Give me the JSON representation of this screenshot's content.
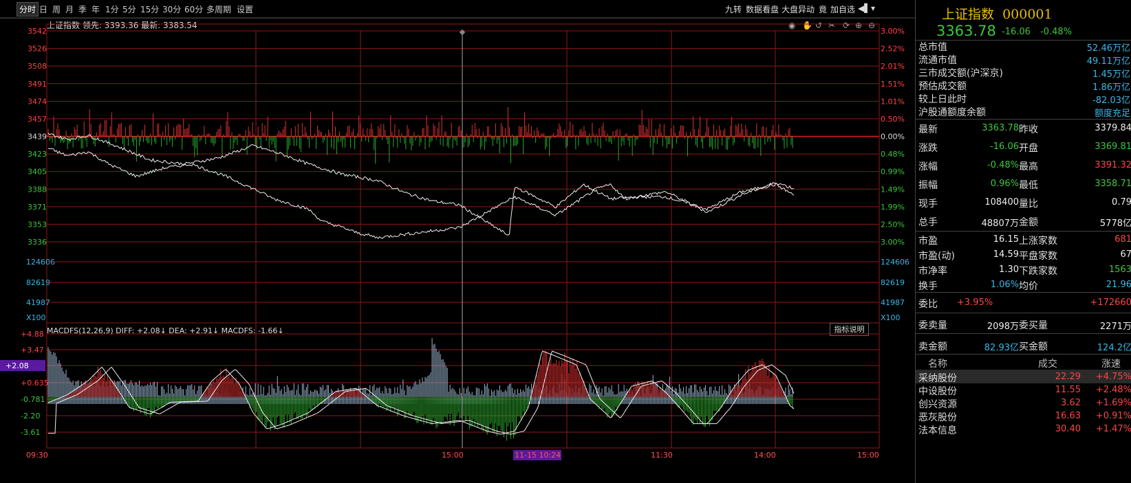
{
  "toolbar": {
    "tabs": [
      "分时",
      "日",
      "周",
      "月",
      "季",
      "年",
      "1分",
      "5分",
      "15分",
      "30分",
      "60分",
      "多周期",
      "设置"
    ],
    "right": [
      "九转",
      "数据看盘",
      "大盘异动",
      "竟",
      "加自选"
    ]
  },
  "chart": {
    "title_name": "上证指数",
    "title_lead": "领先:",
    "lead_value": "3393.36",
    "title_latest": "最新:",
    "latest_value": "3383.54"
  },
  "chart_data": [
    {
      "type": "line",
      "name": "price",
      "y_left_ticks": [
        "3542",
        "3526",
        "3508",
        "3491",
        "3474",
        "3457",
        "3439",
        "3423",
        "3405",
        "3388",
        "3371",
        "3353",
        "3336"
      ],
      "y_right_ticks": [
        "3.00%",
        "2.52%",
        "2.01%",
        "1.51%",
        "1.01%",
        "0.50%",
        "0.00%",
        "0.48%",
        "0.99%",
        "1.49%",
        "1.99%",
        "2.50%",
        "3.00%"
      ],
      "x_ticks": [
        "09:30",
        "15:00",
        "11-15 10:24",
        "11:30",
        "14:00",
        "15:00"
      ],
      "ylim": [
        3336,
        3542
      ],
      "base": 3439
    },
    {
      "type": "bar",
      "name": "volume",
      "y_ticks": [
        "124606",
        "82619",
        "41987",
        "X100"
      ]
    },
    {
      "type": "bar",
      "name": "macd",
      "legend": "MACDFS(12,26,9) DIFF: +2.08↓ DEA: +2.91↓ MACDFS: -1.66↓",
      "y_ticks": [
        "+4.88",
        "+3.47",
        "+2.08",
        "+0.635",
        "-0.781",
        "-2.20",
        "-3.61"
      ],
      "ylim": [
        -4.3,
        5.3
      ]
    }
  ],
  "macd_button": "指标说明",
  "side": {
    "name": "上证指数",
    "code": "000001",
    "price": "3363.78",
    "change": "-16.06",
    "pct": "-0.48%",
    "rows1": [
      {
        "k": "总市值",
        "v": "52.46万亿",
        "c": "cyan"
      },
      {
        "k": "流通市值",
        "v": "49.11万亿",
        "c": "cyan"
      },
      {
        "k": "三市成交额(沪深京)",
        "v": "1.45万亿",
        "c": "cyan"
      },
      {
        "k": "预估成交额",
        "v": "1.86万亿",
        "c": "cyan"
      },
      {
        "k": "较上日此时",
        "v": "-82.03亿",
        "c": "cyan"
      },
      {
        "k": "沪股通额度余额",
        "v": "额度充足",
        "c": "cyan"
      }
    ],
    "rows2": [
      {
        "k1": "最新",
        "v1": "3363.78",
        "c1": "green",
        "k2": "昨收",
        "v2": "3379.84",
        "c2": "white"
      },
      {
        "k1": "涨跌",
        "v1": "-16.06",
        "c1": "green",
        "k2": "开盘",
        "v2": "3369.81",
        "c2": "green"
      },
      {
        "k1": "涨幅",
        "v1": "-0.48%",
        "c1": "green",
        "k2": "最高",
        "v2": "3391.32",
        "c2": "red"
      },
      {
        "k1": "振幅",
        "v1": "0.96%",
        "c1": "green",
        "k2": "最低",
        "v2": "3358.71",
        "c2": "green"
      },
      {
        "k1": "现手",
        "v1": "108400",
        "c1": "white",
        "k2": "量比",
        "v2": "0.79",
        "c2": "white"
      },
      {
        "k1": "总手",
        "v1": "48807万",
        "c1": "white",
        "k2": "金额",
        "v2": "5778亿",
        "c2": "white"
      }
    ],
    "rows3": [
      {
        "k1": "市盈",
        "v1": "16.15",
        "c1": "white",
        "k2": "上涨家数",
        "v2": "681",
        "c2": "red"
      },
      {
        "k1": "市盈(动)",
        "v1": "14.59",
        "c1": "white",
        "k2": "平盘家数",
        "v2": "67",
        "c2": "white"
      },
      {
        "k1": "市净率",
        "v1": "1.30",
        "c1": "white",
        "k2": "下跌家数",
        "v2": "1563",
        "c2": "green"
      },
      {
        "k1": "换手",
        "v1": "1.06%",
        "c1": "cyan",
        "k2": "均价",
        "v2": "21.96",
        "c2": "cyan"
      }
    ],
    "weibi_label": "委比",
    "weibi": "+3.95%",
    "weibi2": "+172660",
    "wm_label": "委卖量",
    "wm": "2098万",
    "wb_label": "委买量",
    "wb": "2271万",
    "mj_label": "卖金额",
    "mj": "82.93亿",
    "bj_label": "买金额",
    "bj": "124.2亿",
    "list_header": [
      "名称",
      "成交",
      "涨速"
    ],
    "list": [
      {
        "name": "采纳股份",
        "price": "22.29",
        "spd": "+4.75%"
      },
      {
        "name": "中设股份",
        "price": "11.55",
        "spd": "+2.48%"
      },
      {
        "name": "创兴资源",
        "price": "3.62",
        "spd": "+1.69%"
      },
      {
        "name": "恶灰股份",
        "price": "16.63",
        "spd": "+0.91%"
      },
      {
        "name": "法本信息",
        "price": "30.40",
        "spd": "+1.47%"
      }
    ]
  }
}
